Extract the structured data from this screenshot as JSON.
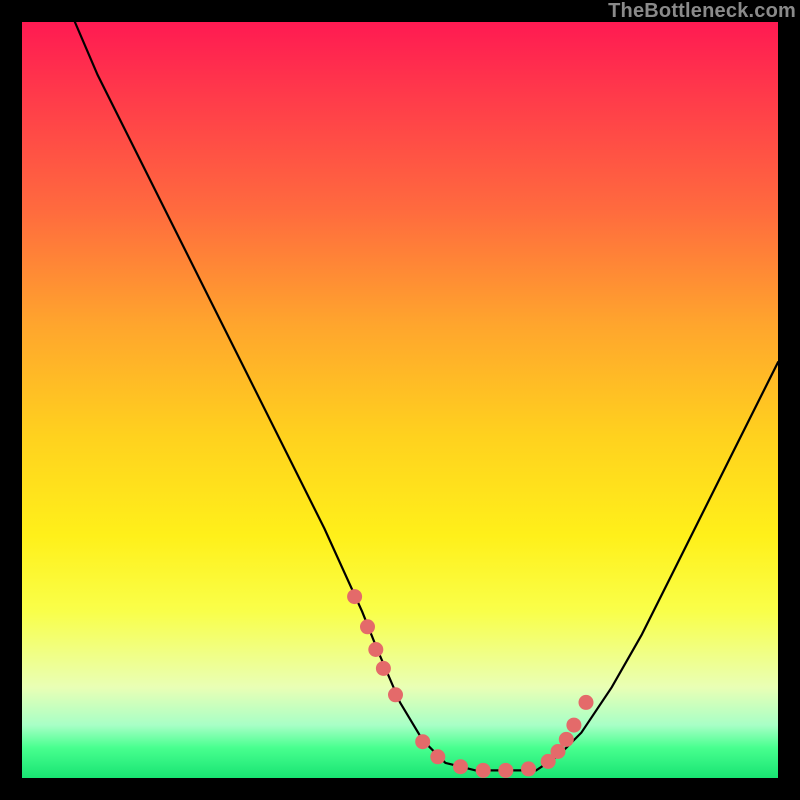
{
  "watermark": "TheBottleneck.com",
  "colors": {
    "background": "#000000",
    "curve_stroke": "#000000",
    "marker_fill": "#e46a6a",
    "gradient_top": "#ff1a52",
    "gradient_bottom": "#18e472"
  },
  "chart_data": {
    "type": "line",
    "title": "",
    "xlabel": "",
    "ylabel": "",
    "xlim": [
      0,
      100
    ],
    "ylim": [
      0,
      100
    ],
    "note": "Axes are unlabeled in the source image; x/y are normalized 0–100 estimates read from pixel positions.",
    "series": [
      {
        "name": "curve",
        "x": [
          7,
          10,
          15,
          20,
          25,
          30,
          35,
          40,
          45,
          47,
          50,
          53,
          56,
          60,
          64,
          68,
          71,
          74,
          78,
          82,
          86,
          90,
          94,
          98,
          100
        ],
        "y": [
          100,
          93,
          83,
          73,
          63,
          53,
          43,
          33,
          22,
          17,
          10,
          5,
          2,
          1,
          1,
          1,
          3,
          6,
          12,
          19,
          27,
          35,
          43,
          51,
          55
        ]
      }
    ],
    "markers": {
      "name": "highlighted-points",
      "x": [
        44.0,
        45.7,
        46.8,
        47.8,
        49.4,
        53.0,
        55.0,
        58.0,
        61.0,
        64.0,
        67.0,
        69.6,
        70.9,
        72.0,
        73.0,
        74.6
      ],
      "y": [
        24.0,
        20.0,
        17.0,
        14.5,
        11.0,
        4.8,
        2.8,
        1.5,
        1.0,
        1.0,
        1.2,
        2.2,
        3.5,
        5.1,
        7.0,
        10.0
      ]
    }
  }
}
